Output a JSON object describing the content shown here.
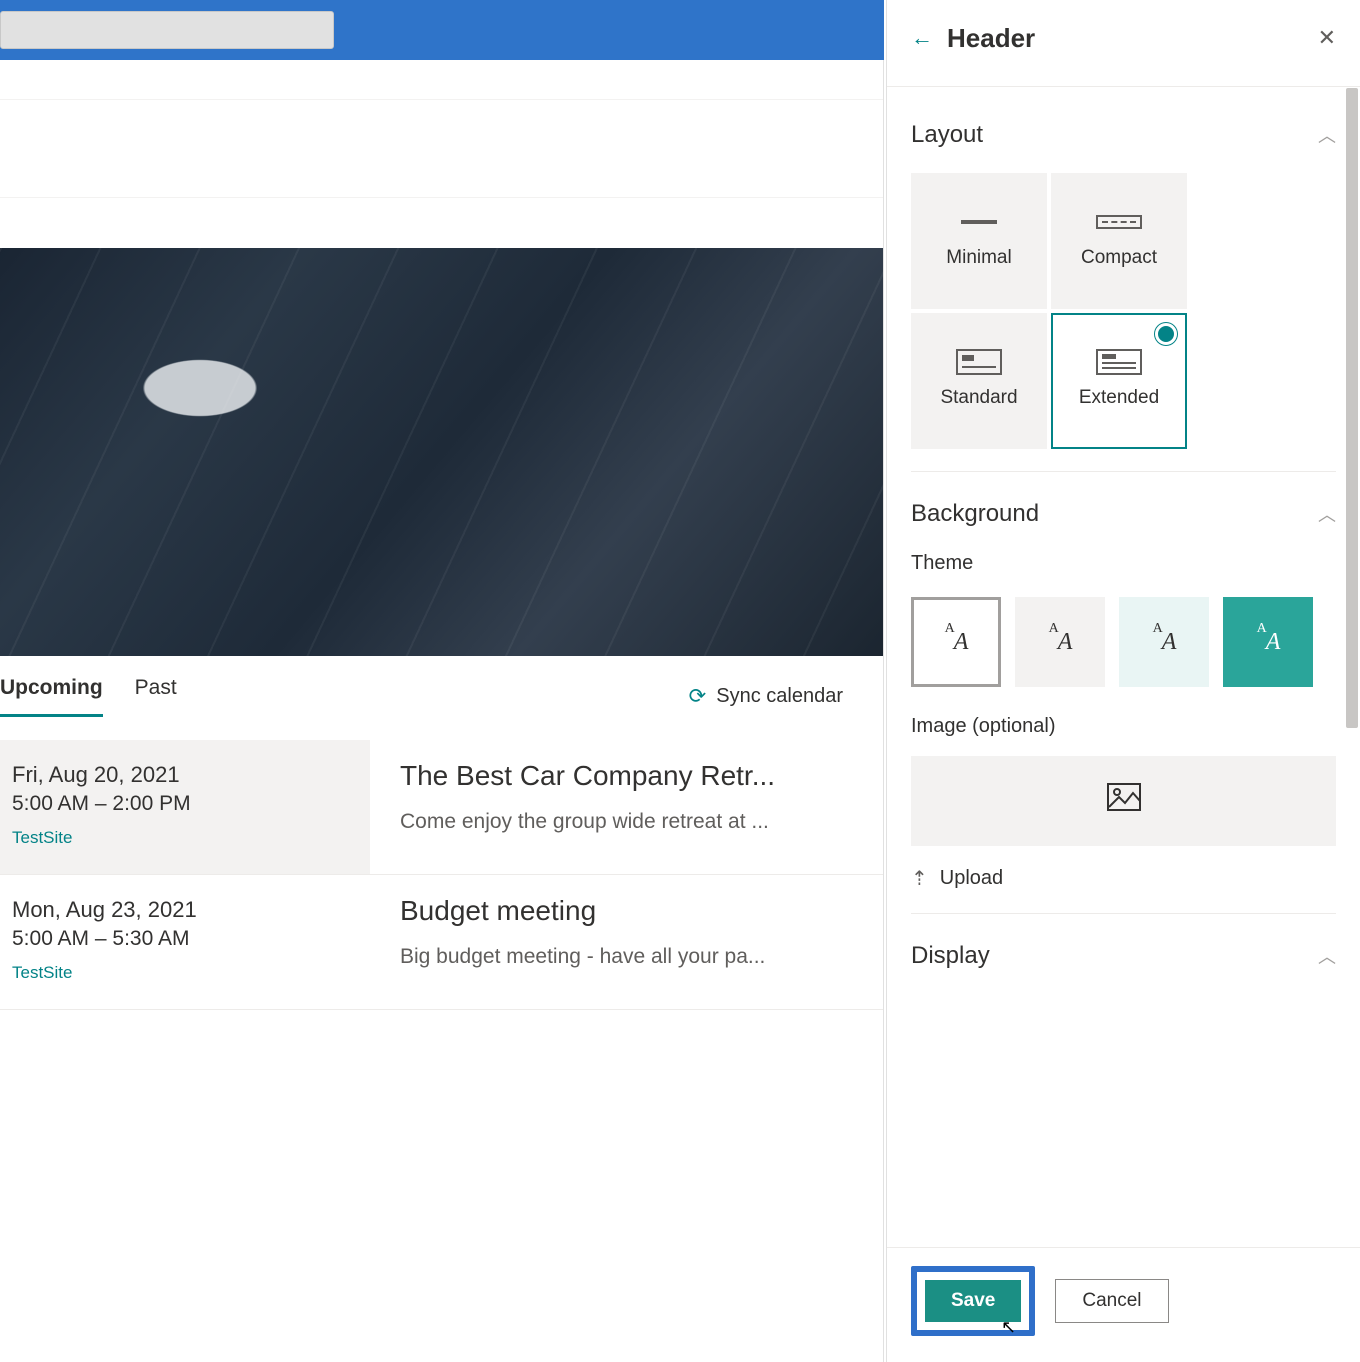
{
  "panel": {
    "title": "Header",
    "sections": {
      "layout": {
        "title": "Layout",
        "options": {
          "minimal": "Minimal",
          "compact": "Compact",
          "standard": "Standard",
          "extended": "Extended"
        },
        "selected": "Extended"
      },
      "background": {
        "title": "Background",
        "theme_label": "Theme",
        "image_label": "Image (optional)",
        "upload_label": "Upload"
      },
      "display": {
        "title": "Display"
      }
    },
    "actions": {
      "save": "Save",
      "cancel": "Cancel"
    }
  },
  "tabs": {
    "upcoming": "Upcoming",
    "past": "Past"
  },
  "sync_label": "Sync calendar",
  "events": [
    {
      "date": "Fri, Aug 20, 2021",
      "time": "5:00 AM – 2:00 PM",
      "site": "TestSite",
      "title": "The Best Car Company Retr...",
      "desc": "Come enjoy the group wide retreat at ..."
    },
    {
      "date": "Mon, Aug 23, 2021",
      "time": "5:00 AM – 5:30 AM",
      "site": "TestSite",
      "title": "Budget meeting",
      "desc": "Big budget meeting - have all your pa..."
    }
  ]
}
